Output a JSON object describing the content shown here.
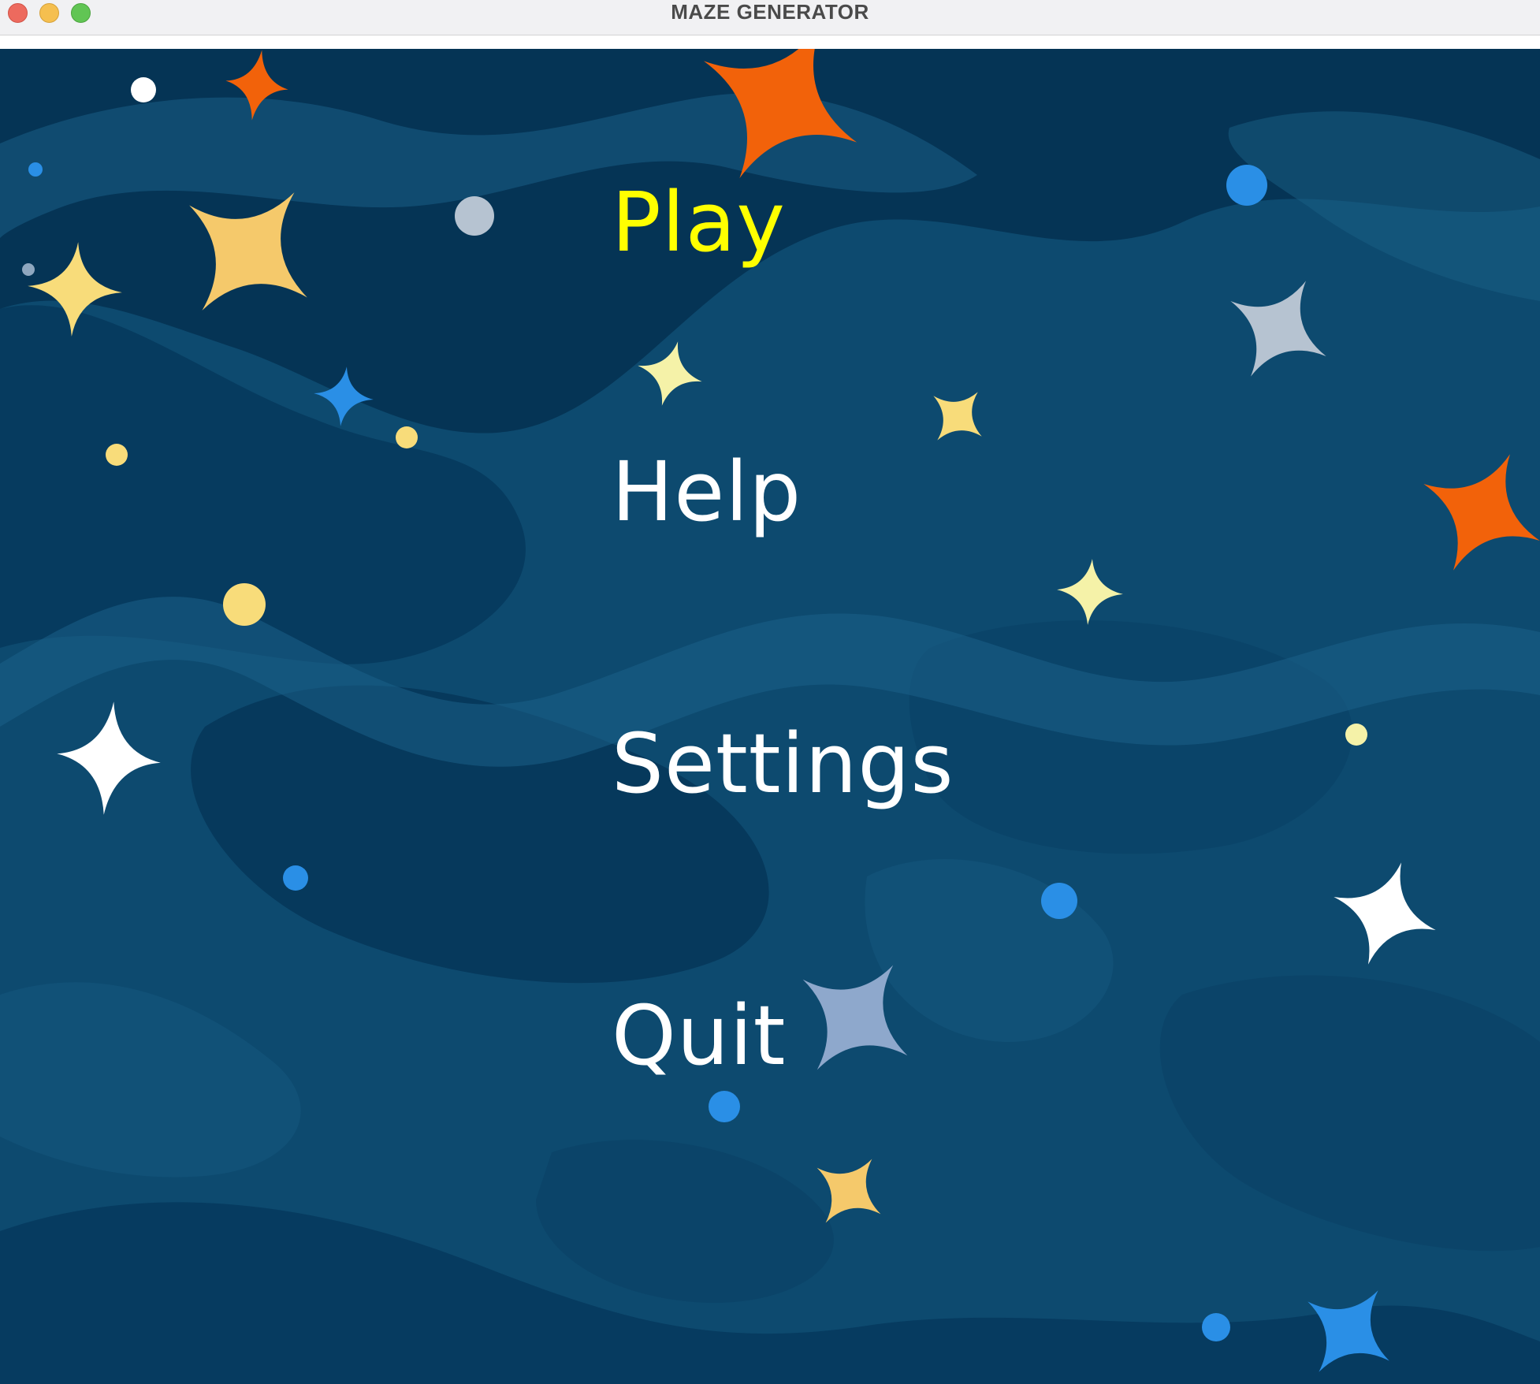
{
  "window": {
    "title": "MAZE GENERATOR",
    "controls": [
      "close-icon",
      "minimize-icon",
      "maximize-icon"
    ]
  },
  "menu": {
    "items": [
      {
        "label": "Play",
        "selected": true
      },
      {
        "label": "Help",
        "selected": false
      },
      {
        "label": "Settings",
        "selected": false
      },
      {
        "label": "Quit",
        "selected": false
      }
    ]
  },
  "colors": {
    "selected_text": "#ffff00",
    "normal_text": "#ffffff",
    "background": "#0d4a6f",
    "star_orange": "#f2620a",
    "star_yellow": "#f5c96b",
    "star_blue": "#2a8fe6"
  }
}
